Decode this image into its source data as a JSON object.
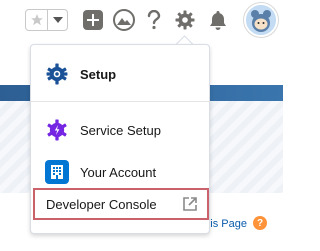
{
  "header": {
    "favorites_star_icon": "star-icon",
    "favorites_menu_icon": "chevron-down-icon",
    "global_actions_icon": "plus-icon",
    "trailhead_icon": "trailhead-icon",
    "help_icon": "question-icon",
    "setup_icon": "gear-icon",
    "notifications_icon": "bell-icon",
    "avatar_icon": "astro-avatar-icon"
  },
  "setup_menu": {
    "items": [
      {
        "label": "Setup",
        "icon": "setup-gear-icon"
      },
      {
        "label": "Service Setup",
        "icon": "service-gear-icon"
      },
      {
        "label": "Your Account",
        "icon": "account-icon"
      },
      {
        "label": "Developer Console",
        "icon": "external-link-icon",
        "highlighted": true
      }
    ]
  },
  "page": {
    "help_link_text": "his Page",
    "help_badge": "?"
  },
  "colors": {
    "setup_icon": "#1b5297",
    "service_icon": "#7526e3",
    "account_icon": "#0176d3",
    "highlight_border": "#c9626b",
    "help_badge": "#fe9339"
  }
}
